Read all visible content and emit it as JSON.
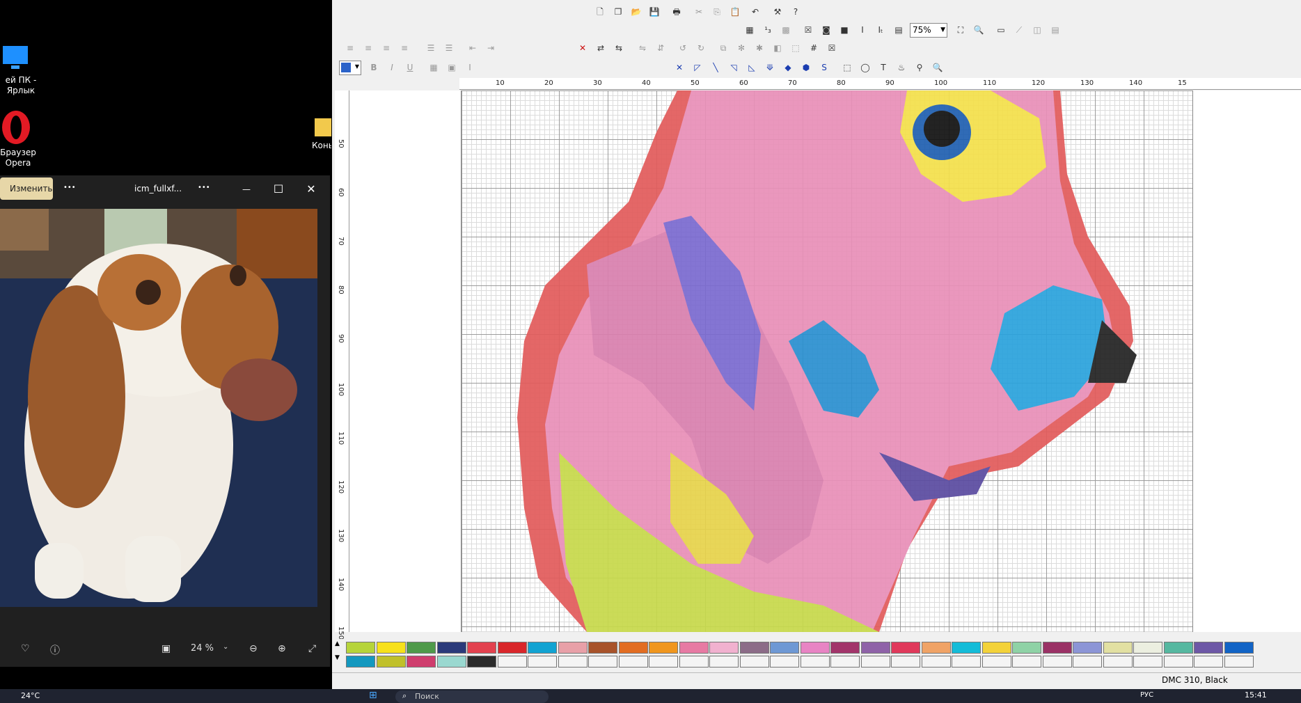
{
  "desktop": {
    "icons": [
      {
        "label": "ей ПК - Ярлык"
      },
      {
        "label": "Браузер Opera"
      },
      {
        "label": "Конь"
      }
    ]
  },
  "photos": {
    "edit_label": "Изменить",
    "more1": "•••",
    "filename": "icm_fullxf...",
    "more2": "•••",
    "minimize": "—",
    "maximize": "☐",
    "close": "✕",
    "zoom": "24 %"
  },
  "editor": {
    "zoom_value": "75%",
    "hruler_labels": [
      "10",
      "20",
      "30",
      "40",
      "50",
      "60",
      "70",
      "80",
      "90",
      "100",
      "110",
      "120",
      "130",
      "140",
      "15"
    ],
    "vruler_labels": [
      "50",
      "60",
      "70",
      "80",
      "90",
      "100",
      "110",
      "120",
      "130",
      "140",
      "150"
    ],
    "status_text": "DMC  310, Black",
    "palette_row1": [
      "#b6d43a",
      "#f7e11b",
      "#4f9a4a",
      "#2b3a7a",
      "#e3424f",
      "#d9262a",
      "#12a3d2",
      "#e8a0a8",
      "#a8532a",
      "#e26d22",
      "#f0961e",
      "#e77aa3",
      "#f1b1cf",
      "#8c6c88",
      "#6e98d4",
      "#e884c4",
      "#a2346a",
      "#8f62a8",
      "#e0395b",
      "#f0a366",
      "#14bcd8",
      "#f3d23a",
      "#8fd2a6",
      "#9a3165",
      "#8c95d6",
      "#e2e0a2",
      "#ecefe0",
      "#56b8a0",
      "#6d58a6",
      "#1264c6"
    ],
    "palette_row2": [
      "#1398bf",
      "#c0c02a",
      "#cf3e6e",
      "#9ad8d0",
      "#2b2b2b"
    ]
  },
  "taskbar": {
    "weather": "24°C",
    "search": "Поиск",
    "lang": "РУС",
    "clock": "15:41"
  }
}
